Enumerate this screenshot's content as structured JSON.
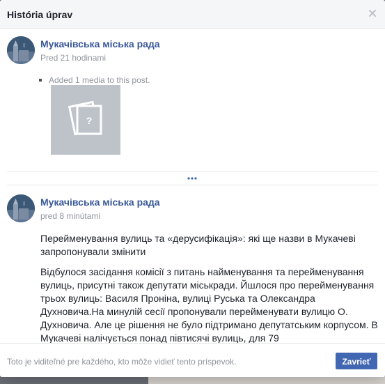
{
  "dialog": {
    "title": "História úprav",
    "close_icon": "close-icon"
  },
  "entries": [
    {
      "author": "Мукачівська міська рада",
      "time": "Pred 21 hodinami",
      "change": "Added 1 media to this post.",
      "media_icon": "photo-placeholder-icon"
    },
    {
      "author": "Мукачівська міська рада",
      "time": "pred 8 minútami",
      "paragraphs": [
        "Перейменування вулиць та «дерусифікація»: які ще назви в Мукачеві запропонували змінити",
        "Відбулося засідання комісії з питань найменування та перейменування вулиць, присутні також депутати міськради. Йшлося про перейменування трьох вулиць: Василя Проніна, вулиці Руська та Олександра Духновича.На минулій сесії пропонували перейменувати вулицю О. Духновича. Але це рішення не було підтримано депутатським корпусом. В Мукачеві налічується понад півтисячі вулиць, для 79"
      ]
    }
  ],
  "more_icon": "more-dots-icon",
  "footer": {
    "note": "Toto je viditeľné pre každého, kto môže vidieť tento príspevok.",
    "button": "Zavrieť"
  },
  "colors": {
    "link": "#385898",
    "button": "#4267b2",
    "muted": "#90949c"
  }
}
